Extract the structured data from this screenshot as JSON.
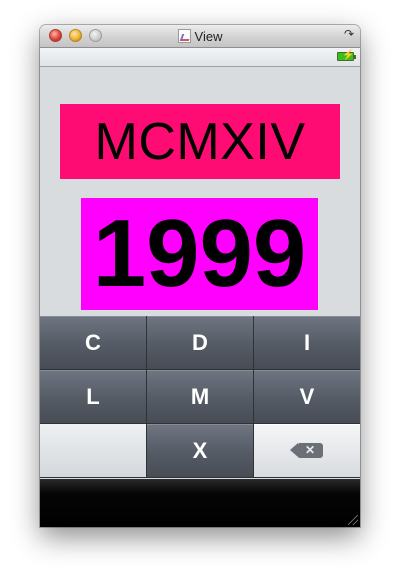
{
  "window": {
    "title": "View"
  },
  "display": {
    "roman": "MCMXIV",
    "arabic": "1999",
    "roman_bg": "#ff0b74",
    "arabic_bg": "#ff00ff"
  },
  "keypad": {
    "row1": [
      "C",
      "D",
      "I"
    ],
    "row2": [
      "L",
      "M",
      "V"
    ],
    "row3": [
      "",
      "X",
      "⌫"
    ]
  },
  "colors": {
    "key_dark": "#555b65",
    "key_light": "#e4e7ea",
    "battery": "#38c11c"
  },
  "icons": {
    "battery": "battery-charging-icon",
    "backspace": "backspace-icon"
  }
}
